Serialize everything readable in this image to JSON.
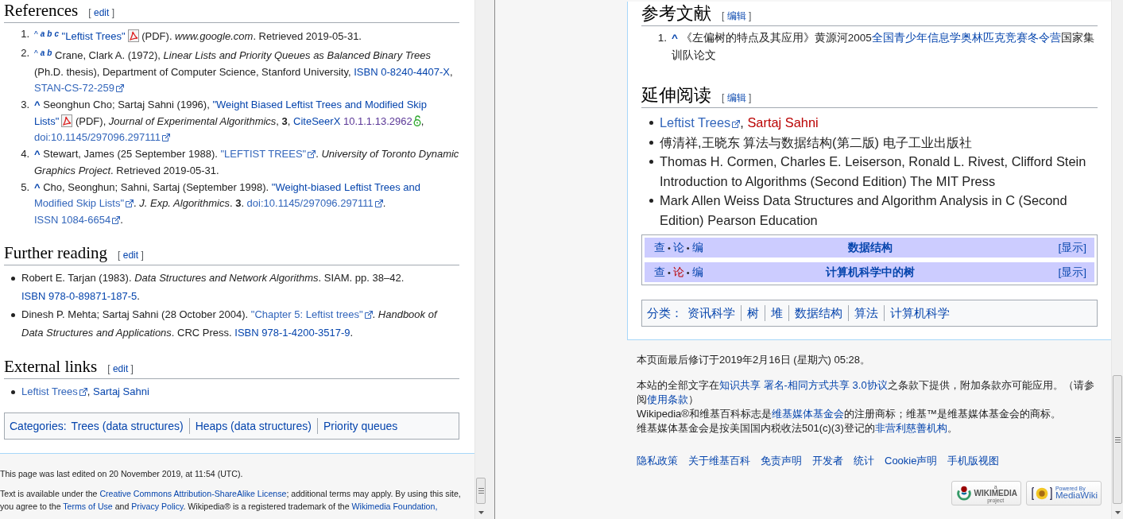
{
  "left_page": {
    "references": {
      "heading": "References",
      "edit": {
        "before": "[",
        "label": "edit",
        "after": "]"
      },
      "items": [
        {
          "num": "1.",
          "segs": [
            {
              "kind": "caret",
              "t": "^"
            },
            {
              "kind": "sup",
              "t": "a"
            },
            {
              "kind": "sup",
              "t": "b"
            },
            {
              "kind": "sup",
              "t": "c"
            },
            {
              "kind": "space"
            },
            {
              "kind": "link",
              "t": "\"Leftist Trees\""
            },
            {
              "kind": "pdf"
            },
            {
              "kind": "text",
              "t": " (PDF). "
            },
            {
              "kind": "italic",
              "t": "www.google.com"
            },
            {
              "kind": "text",
              "t": ". Retrieved 2019-05-31."
            }
          ]
        },
        {
          "num": "2.",
          "segs": [
            {
              "kind": "caret",
              "t": "^"
            },
            {
              "kind": "sup",
              "t": "a"
            },
            {
              "kind": "sup",
              "t": "b"
            },
            {
              "kind": "text",
              "t": " Crane, Clark A. (1972), "
            },
            {
              "kind": "italic",
              "t": "Linear Lists and Priority Queues as Balanced Binary Trees"
            },
            {
              "kind": "text",
              "t": " (Ph.D. thesis), Department of Computer Science, Stanford University, "
            },
            {
              "kind": "link",
              "t": "ISBN 0-8240-4407-X"
            },
            {
              "kind": "text",
              "t": ", "
            },
            {
              "kind": "ext",
              "t": "STAN-CS-72-259"
            }
          ]
        },
        {
          "num": "3.",
          "segs": [
            {
              "kind": "back",
              "t": "^"
            },
            {
              "kind": "text",
              "t": " Seonghun Cho; Sartaj Sahni (1996), "
            },
            {
              "kind": "link",
              "t": "\"Weight Biased Leftist Trees and Modified Skip"
            },
            {
              "kind": "space"
            },
            {
              "kind": "link",
              "t": "Lists\""
            },
            {
              "kind": "pdf"
            },
            {
              "kind": "text",
              "t": " (PDF), "
            },
            {
              "kind": "italic",
              "t": "Journal of Experimental Algorithmics"
            },
            {
              "kind": "text",
              "t": ", "
            },
            {
              "kind": "bold",
              "t": "3"
            },
            {
              "kind": "text",
              "t": ", "
            },
            {
              "kind": "link",
              "t": "CiteSeerX"
            },
            {
              "kind": "space"
            },
            {
              "kind": "visited",
              "t": "10.1.1.13.2962"
            },
            {
              "kind": "lock"
            },
            {
              "kind": "text",
              "t": ", "
            },
            {
              "kind": "ext",
              "t": "doi:10.1145/297096.297111"
            }
          ]
        },
        {
          "num": "4.",
          "segs": [
            {
              "kind": "back",
              "t": "^"
            },
            {
              "kind": "text",
              "t": " Stewart, James (25 September 1988). "
            },
            {
              "kind": "ext",
              "t": "\"LEFTIST TREES\""
            },
            {
              "kind": "text",
              "t": ". "
            },
            {
              "kind": "italic",
              "t": "University of Toronto Dynamic Graphics Project"
            },
            {
              "kind": "text",
              "t": ". Retrieved 2019-05-31."
            }
          ]
        },
        {
          "num": "5.",
          "segs": [
            {
              "kind": "back",
              "t": "^"
            },
            {
              "kind": "text",
              "t": " Cho, Seonghun; Sahni, Sartaj (September 1998). "
            },
            {
              "kind": "link",
              "t": "\"Weight-biased Leftist Trees and"
            },
            {
              "kind": "space"
            },
            {
              "kind": "ext",
              "t": "Modified Skip Lists\""
            },
            {
              "kind": "text",
              "t": ". "
            },
            {
              "kind": "italic",
              "t": "J. Exp. Algorithmics"
            },
            {
              "kind": "text",
              "t": ". "
            },
            {
              "kind": "bold",
              "t": "3"
            },
            {
              "kind": "text",
              "t": ". "
            },
            {
              "kind": "ext",
              "t": "doi:10.1145/297096.297111"
            },
            {
              "kind": "text",
              "t": ". "
            },
            {
              "kind": "ext",
              "t": "ISSN 1084-6654"
            },
            {
              "kind": "text",
              "t": "."
            }
          ]
        }
      ]
    },
    "further_reading": {
      "heading": "Further reading",
      "edit": {
        "before": "[",
        "label": "edit",
        "after": "]"
      },
      "items": [
        {
          "segs": [
            {
              "kind": "text",
              "t": "Robert E. Tarjan (1983). "
            },
            {
              "kind": "italic",
              "t": "Data Structures and Network Algorithms"
            },
            {
              "kind": "text",
              "t": ". SIAM. pp. 38–42. "
            },
            {
              "kind": "link",
              "t": "ISBN 978-0-89871-187-5"
            },
            {
              "kind": "text",
              "t": "."
            }
          ]
        },
        {
          "segs": [
            {
              "kind": "text",
              "t": "Dinesh P. Mehta; Sartaj Sahni (28 October 2004). "
            },
            {
              "kind": "ext",
              "t": "\"Chapter 5: Leftist trees\""
            },
            {
              "kind": "text",
              "t": ". "
            },
            {
              "kind": "italic",
              "t": "Handbook of Data Structures and Applications"
            },
            {
              "kind": "text",
              "t": ". CRC Press. "
            },
            {
              "kind": "link",
              "t": "ISBN 978-1-4200-3517-9"
            },
            {
              "kind": "text",
              "t": "."
            }
          ]
        }
      ]
    },
    "external_links": {
      "heading": "External links",
      "edit": {
        "before": "[",
        "label": "edit",
        "after": "]"
      },
      "items": [
        {
          "segs": [
            {
              "kind": "ext",
              "t": "Leftist Trees"
            },
            {
              "kind": "text",
              "t": ", "
            },
            {
              "kind": "link",
              "t": "Sartaj Sahni"
            }
          ]
        }
      ]
    },
    "categories": {
      "label": "Categories:",
      "items": [
        "Trees (data structures)",
        "Heaps (data structures)",
        "Priority queues"
      ]
    },
    "footer": {
      "last_edited": "This page was last edited on 20 November 2019, at 11:54 (UTC).",
      "license": [
        {
          "kind": "text",
          "t": "Text is available under the "
        },
        {
          "kind": "link",
          "t": "Creative Commons Attribution-ShareAlike License"
        },
        {
          "kind": "text",
          "t": "; additional terms may apply. By using this site, you agree to the "
        },
        {
          "kind": "link",
          "t": "Terms of Use"
        },
        {
          "kind": "text",
          "t": " and "
        },
        {
          "kind": "link",
          "t": "Privacy Policy"
        },
        {
          "kind": "text",
          "t": ". Wikipedia® is a registered trademark of the "
        },
        {
          "kind": "link",
          "t": "Wikimedia Foundation,"
        }
      ]
    }
  },
  "right_page": {
    "references": {
      "heading": "参考文献",
      "edit": {
        "before": "[",
        "label": "编辑",
        "after": "]"
      },
      "items": [
        {
          "num": "1.",
          "segs": [
            {
              "kind": "back",
              "t": "^"
            },
            {
              "kind": "text",
              "t": " 《左偏树的特点及其应用》黄源河2005"
            },
            {
              "kind": "link",
              "t": "全国青少年信息学奥林匹克竞赛冬令营"
            },
            {
              "kind": "text",
              "t": "国家集训队论文"
            }
          ]
        }
      ]
    },
    "further_reading": {
      "heading": "延伸阅读",
      "edit": {
        "before": "[",
        "label": "编辑",
        "after": "]"
      },
      "items": [
        {
          "segs": [
            {
              "kind": "ext",
              "t": "Leftist Trees"
            },
            {
              "kind": "text",
              "t": ", "
            },
            {
              "kind": "redlink",
              "t": "Sartaj Sahni"
            }
          ]
        },
        {
          "segs": [
            {
              "kind": "text",
              "t": "傅清祥,王晓东 算法与数据结构(第二版) 电子工业出版社"
            }
          ]
        },
        {
          "segs": [
            {
              "kind": "text",
              "t": "Thomas H. Cormen, Charles E. Leiserson, Ronald L. Rivest, Clifford Stein Introduction to Algorithms (Second Edition) The MIT Press"
            }
          ]
        },
        {
          "segs": [
            {
              "kind": "text",
              "t": "Mark Allen Weiss Data Structures and Algorithm Analysis in C (Second Edition) Pearson Education"
            }
          ]
        }
      ]
    },
    "navboxes": [
      {
        "navbar": [
          {
            "kind": "link",
            "t": "查"
          },
          {
            "kind": "dot",
            "t": "•"
          },
          {
            "kind": "link",
            "t": "论"
          },
          {
            "kind": "dot",
            "t": "•"
          },
          {
            "kind": "link",
            "t": "编"
          }
        ],
        "title": "数据结构",
        "toggle": "[显示]"
      },
      {
        "navbar": [
          {
            "kind": "link",
            "t": "查"
          },
          {
            "kind": "dot",
            "t": "•"
          },
          {
            "kind": "redlink",
            "t": "论"
          },
          {
            "kind": "dot",
            "t": "•"
          },
          {
            "kind": "link",
            "t": "编"
          }
        ],
        "title": "计算机科学中的树",
        "toggle": "[显示]"
      }
    ],
    "categories": {
      "label": "分类：",
      "items": [
        "资讯科学",
        "树",
        "堆",
        "数据结构",
        "算法",
        "计算机科学"
      ]
    },
    "footer": {
      "last_edited": "本页面最后修订于2019年2月16日 (星期六) 05:28。",
      "license": [
        {
          "kind": "text",
          "t": "本站的全部文字在"
        },
        {
          "kind": "link",
          "t": "知识共享 署名-相同方式共享 3.0协议"
        },
        {
          "kind": "text",
          "t": "之条款下提供，附加条款亦可能应用。（请参阅"
        },
        {
          "kind": "link",
          "t": "使用条款"
        },
        {
          "kind": "text",
          "t": "）"
        }
      ],
      "trademark": [
        {
          "kind": "text",
          "t": "Wikipedia®和维基百科标志是"
        },
        {
          "kind": "link",
          "t": "维基媒体基金会"
        },
        {
          "kind": "text",
          "t": "的注册商标；维基™是维基媒体基金会的商标。"
        }
      ],
      "nonprofit": [
        {
          "kind": "text",
          "t": "维基媒体基金会是按美国国内税收法501(c)(3)登记的"
        },
        {
          "kind": "link",
          "t": "非营利慈善机构"
        },
        {
          "kind": "text",
          "t": "。"
        }
      ],
      "links": [
        "隐私政策",
        "关于维基百科",
        "免责声明",
        "开发者",
        "统计",
        "Cookie声明",
        "手机版视图"
      ],
      "badges": [
        {
          "kind": "wikimedia",
          "lines": [
            "a",
            "WIKIMEDIA",
            "project"
          ]
        },
        {
          "kind": "mediawiki",
          "lines": [
            "Powered By",
            "MediaWiki"
          ]
        }
      ]
    }
  }
}
